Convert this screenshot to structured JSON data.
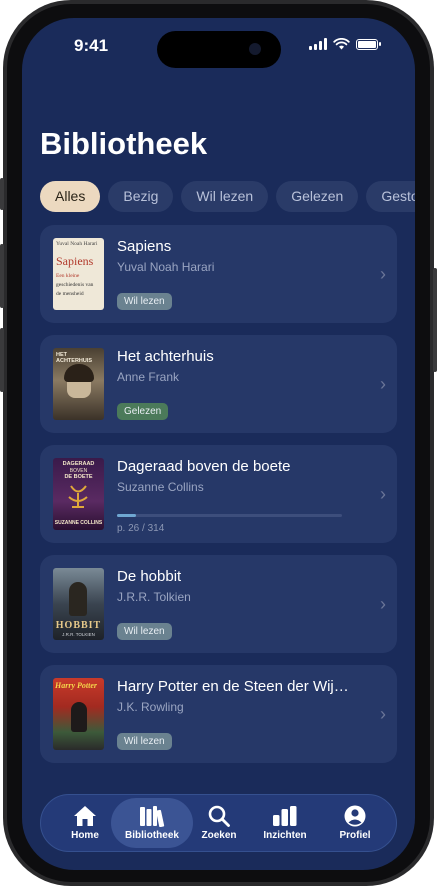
{
  "status": {
    "time": "9:41"
  },
  "header": {
    "title": "Bibliotheek"
  },
  "filters": [
    "Alles",
    "Bezig",
    "Wil lezen",
    "Gelezen",
    "Gestopt"
  ],
  "books": [
    {
      "title": "Sapiens",
      "author": "Yuval Noah Harari",
      "status": "Wil lezen",
      "cover": {
        "line1": "Yuval Noah Harari",
        "line2": "Sapiens",
        "line3": "Een kleine",
        "line4": "geschiedenis van",
        "line5": "de mensheid"
      }
    },
    {
      "title": "Het achterhuis",
      "author": "Anne Frank",
      "status": "Gelezen",
      "cover": {
        "line1": "HET ACHTERHUIS"
      }
    },
    {
      "title": "Dageraad boven de boete",
      "author": "Suzanne Collins",
      "progress_text": "p. 26 / 314",
      "progress": 0.083,
      "cover": {
        "line1": "DAGERAAD",
        "line2": "BOVEN",
        "line3": "DE BOETE",
        "line4": "SUZANNE COLLINS"
      }
    },
    {
      "title": "De hobbit",
      "author": "J.R.R. Tolkien",
      "status": "Wil lezen",
      "cover": {
        "line1": "HOBBIT",
        "line2": "J.R.R. TOLKIEN"
      }
    },
    {
      "title": "Harry Potter en de Steen der Wijzen",
      "author": "J.K. Rowling",
      "status": "Wil lezen",
      "cover": {
        "line1": "Harry Potter"
      }
    }
  ],
  "tabs": [
    {
      "label": "Home",
      "icon": "home-icon"
    },
    {
      "label": "Bibliotheek",
      "icon": "library-icon"
    },
    {
      "label": "Zoeken",
      "icon": "search-icon"
    },
    {
      "label": "Inzichten",
      "icon": "bar-chart-icon"
    },
    {
      "label": "Profiel",
      "icon": "person-icon"
    }
  ]
}
